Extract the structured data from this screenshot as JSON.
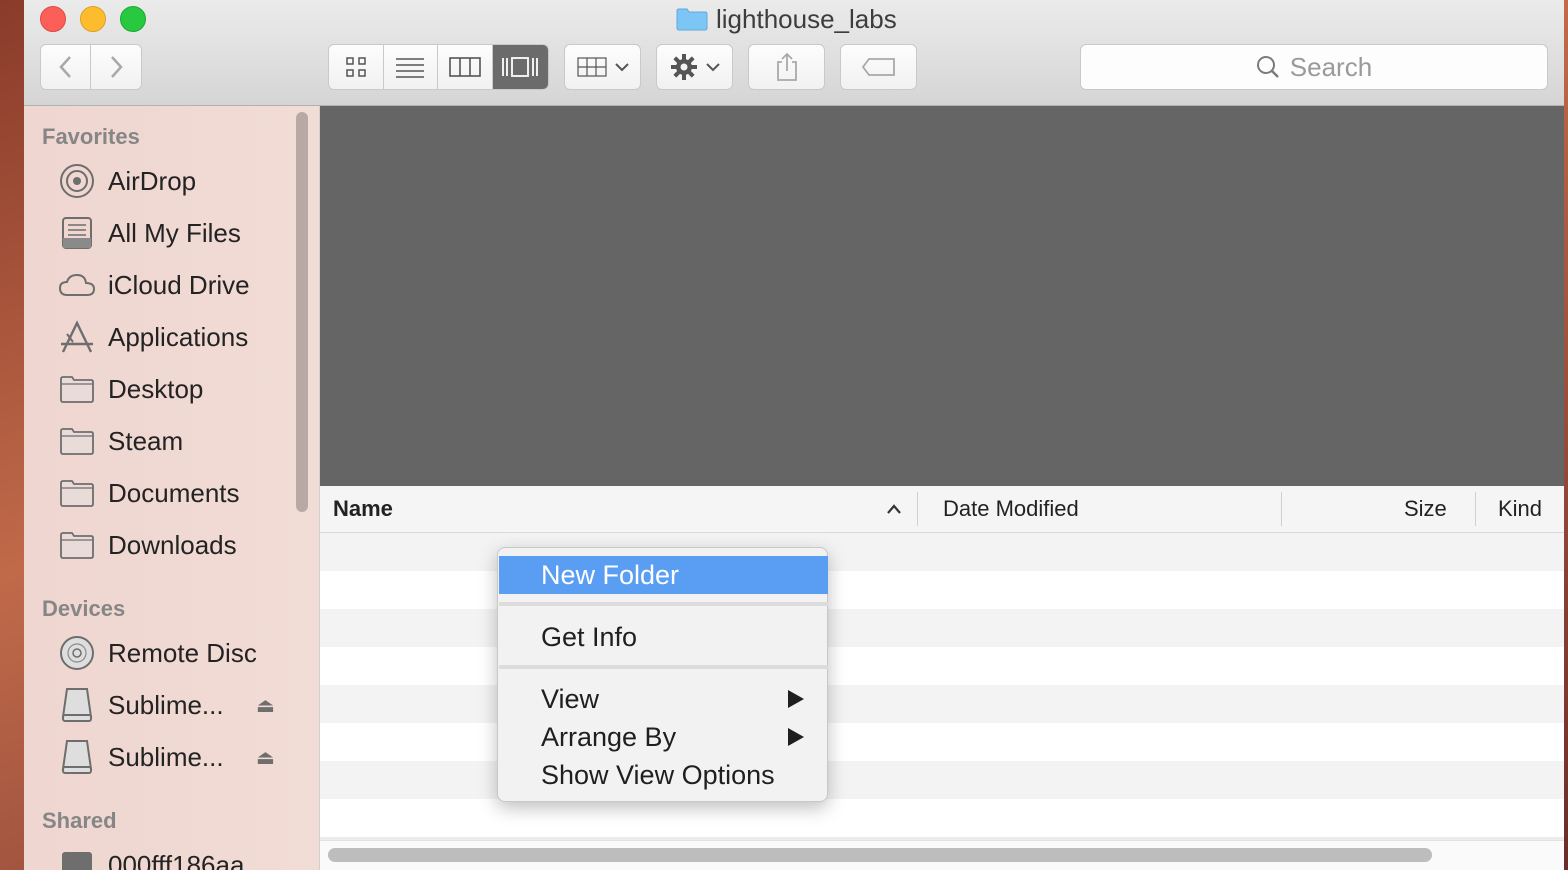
{
  "window": {
    "title": "lighthouse_labs"
  },
  "toolbar": {
    "view_modes": [
      "icon",
      "list",
      "column",
      "cover-flow"
    ],
    "active_view": "cover-flow",
    "search_placeholder": "Search"
  },
  "sidebar": {
    "favorites_header": "Favorites",
    "favorites": [
      {
        "label": "AirDrop",
        "icon": "airdrop-icon"
      },
      {
        "label": "All My Files",
        "icon": "all-files-icon"
      },
      {
        "label": "iCloud Drive",
        "icon": "cloud-icon"
      },
      {
        "label": "Applications",
        "icon": "applications-icon"
      },
      {
        "label": "Desktop",
        "icon": "folder-icon"
      },
      {
        "label": "Steam",
        "icon": "folder-icon"
      },
      {
        "label": "Documents",
        "icon": "folder-icon"
      },
      {
        "label": "Downloads",
        "icon": "folder-icon"
      }
    ],
    "devices_header": "Devices",
    "devices": [
      {
        "label": "Remote Disc",
        "icon": "disc-icon"
      },
      {
        "label": "Sublime...",
        "icon": "drive-icon",
        "eject": "⏏"
      },
      {
        "label": "Sublime...",
        "icon": "drive-icon",
        "eject": "⏏"
      }
    ],
    "shared_header": "Shared",
    "shared": [
      {
        "label": "000fff186aa",
        "icon": "computer-icon"
      }
    ]
  },
  "list": {
    "columns": {
      "name": "Name",
      "date": "Date Modified",
      "size": "Size",
      "kind": "Kind"
    }
  },
  "context_menu": {
    "new_folder": "New Folder",
    "get_info": "Get Info",
    "view": "View",
    "arrange_by": "Arrange By",
    "show_view_options": "Show View Options"
  },
  "colors": {
    "selection": "#5a9ef3",
    "preview_bg": "#656565",
    "sidebar_bg": "#efd6d0"
  }
}
